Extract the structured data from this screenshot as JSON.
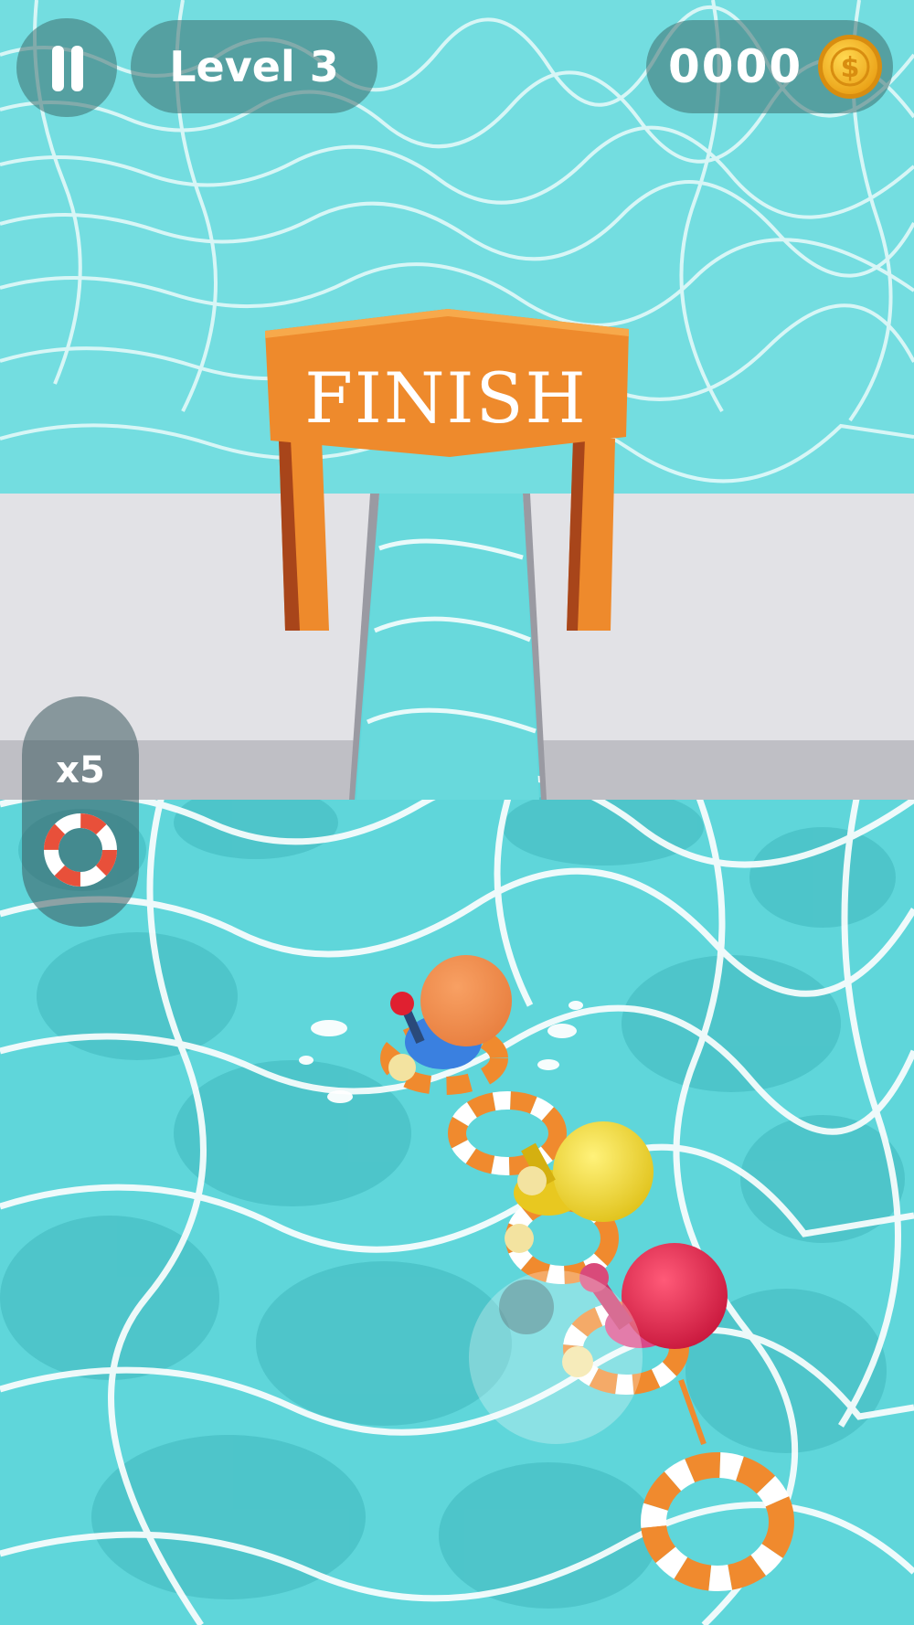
{
  "hud": {
    "level_label": "Level 3",
    "coins": "0000",
    "coin_symbol": "$"
  },
  "scene": {
    "finish_text": "FINISH"
  },
  "powerup": {
    "lives_count": "x5",
    "icon": "life-ring-icon"
  },
  "colors": {
    "water": "#5fd8dc",
    "finish_orange": "#ef8a2c",
    "platform": "#e2e2e6",
    "ring_orange": "#f08a2e",
    "coin_gold": "#f5b320"
  }
}
